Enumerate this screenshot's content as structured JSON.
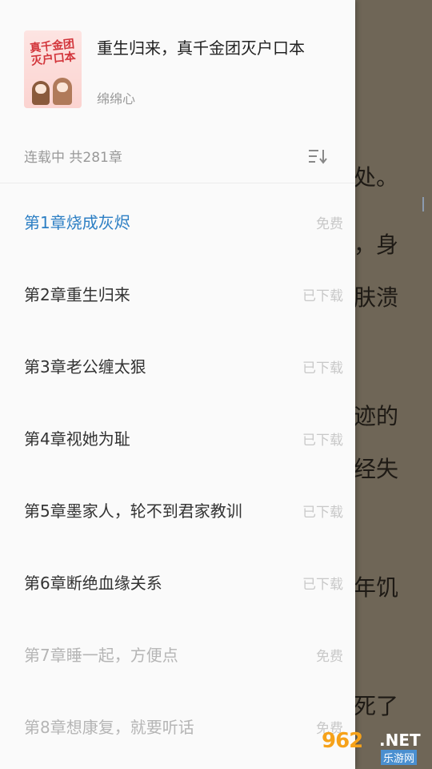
{
  "reader": {
    "lines": [
      "处。",
      "，身",
      "肤溃",
      "迹的",
      "经失",
      "年饥",
      "死了"
    ]
  },
  "drawer": {
    "book": {
      "title": "重生归来，真千金团灭户口本",
      "author": "绵绵心",
      "cover_text": "真千金团灭户口本"
    },
    "status": "连载中 共281章",
    "sort_icon": "sort-icon",
    "chapters": [
      {
        "title": "第1章烧成灰烬",
        "status": "免费"
      },
      {
        "title": "第2章重生归来",
        "status": "已下载"
      },
      {
        "title": "第3章老公缠太狠",
        "status": "已下载"
      },
      {
        "title": "第4章视她为耻",
        "status": "已下载"
      },
      {
        "title": "第5章墨家人，轮不到君家教训",
        "status": "已下载"
      },
      {
        "title": "第6章断绝血缘关系",
        "status": "已下载"
      },
      {
        "title": "第7章睡一起，方便点",
        "status": "免费"
      },
      {
        "title": "第8章想康复，就要听话",
        "status": "免费"
      }
    ],
    "current_index": 0
  },
  "watermark": {
    "brand": "962",
    "domain": ".NET",
    "sub": "乐游网"
  },
  "colors": {
    "accent": "#2d7fc4",
    "reader_bg": "#6f6657"
  }
}
